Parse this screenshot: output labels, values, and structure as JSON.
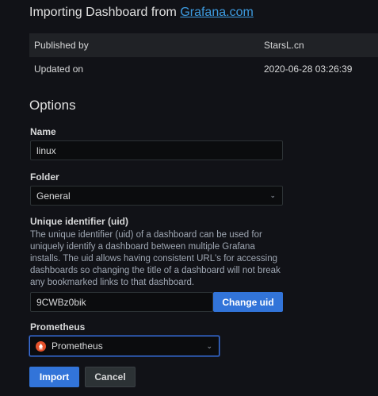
{
  "header": {
    "title_prefix": "Importing Dashboard from ",
    "title_link": "Grafana.com"
  },
  "info": {
    "rows": [
      {
        "label": "Published by",
        "value": "StarsL.cn"
      },
      {
        "label": "Updated on",
        "value": "2020-06-28 03:26:39"
      }
    ]
  },
  "options": {
    "title": "Options",
    "name_label": "Name",
    "name_value": "linux",
    "folder_label": "Folder",
    "folder_value": "General",
    "uid_label": "Unique identifier (uid)",
    "uid_description": "The unique identifier (uid) of a dashboard can be used for uniquely identify a dashboard between multiple Grafana installs. The uid allows having consistent URL's for accessing dashboards so changing the title of a dashboard will not break any bookmarked links to that dashboard.",
    "uid_value": "9CWBz0bik",
    "change_uid_label": "Change uid",
    "prometheus_label": "Prometheus",
    "prometheus_value": "Prometheus"
  },
  "actions": {
    "import_label": "Import",
    "cancel_label": "Cancel"
  },
  "colors": {
    "background": "#111217",
    "primary": "#3274d9",
    "link": "#3d9be0",
    "prometheus": "#e6522c"
  }
}
